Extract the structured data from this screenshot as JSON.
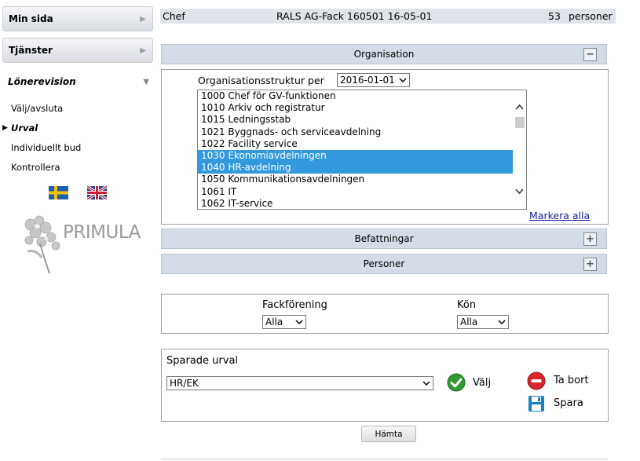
{
  "sidebar": {
    "min_sida": "Min sida",
    "tjanster": "Tjänster",
    "section_title": "Lönerevision",
    "links": [
      "Välj/avsluta",
      "Urval",
      "Individuellt bud",
      "Kontrollera"
    ],
    "active_link": "Urval",
    "logo_text": "PRIMULA"
  },
  "infobar": {
    "role": "Chef",
    "reference": "RALS AG-Fack 160501 16-05-01",
    "count": "53",
    "count_unit": "personer"
  },
  "organisation": {
    "title": "Organisation",
    "struct_label": "Organisationsstruktur per",
    "date_value": "2016-01-01",
    "items": [
      {
        "label": "1000 Chef för GV-funktionen",
        "selected": false
      },
      {
        "label": "1010 Arkiv och registratur",
        "selected": false
      },
      {
        "label": "1015 Ledningsstab",
        "selected": false
      },
      {
        "label": "1021 Byggnads- och serviceavdelning",
        "selected": false
      },
      {
        "label": "1022 Facility service",
        "selected": false
      },
      {
        "label": "1030 Ekonomiavdelningen",
        "selected": true
      },
      {
        "label": "1040 HR-avdelning",
        "selected": true
      },
      {
        "label": "1050 Kommunikationsavdelningen",
        "selected": false
      },
      {
        "label": "1061 IT",
        "selected": false
      },
      {
        "label": "1062 IT-service",
        "selected": false
      }
    ],
    "mark_all": "Markera alla"
  },
  "befattningar": {
    "title": "Befattningar"
  },
  "personer": {
    "title": "Personer"
  },
  "filters": {
    "fackforening_label": "Fackförening",
    "fackforening_value": "Alla",
    "kon_label": "Kön",
    "kon_value": "Alla"
  },
  "saved": {
    "title": "Sparade urval",
    "selected_value": "HR/EK",
    "valj": "Välj",
    "ta_bort": "Ta bort",
    "spara": "Spara"
  },
  "hamta": "Hämta",
  "colors": {
    "selection": "#3399dd",
    "accordion": "#d4dde7",
    "infobar": "#dfe4ea",
    "link": "#1a1aa6"
  }
}
